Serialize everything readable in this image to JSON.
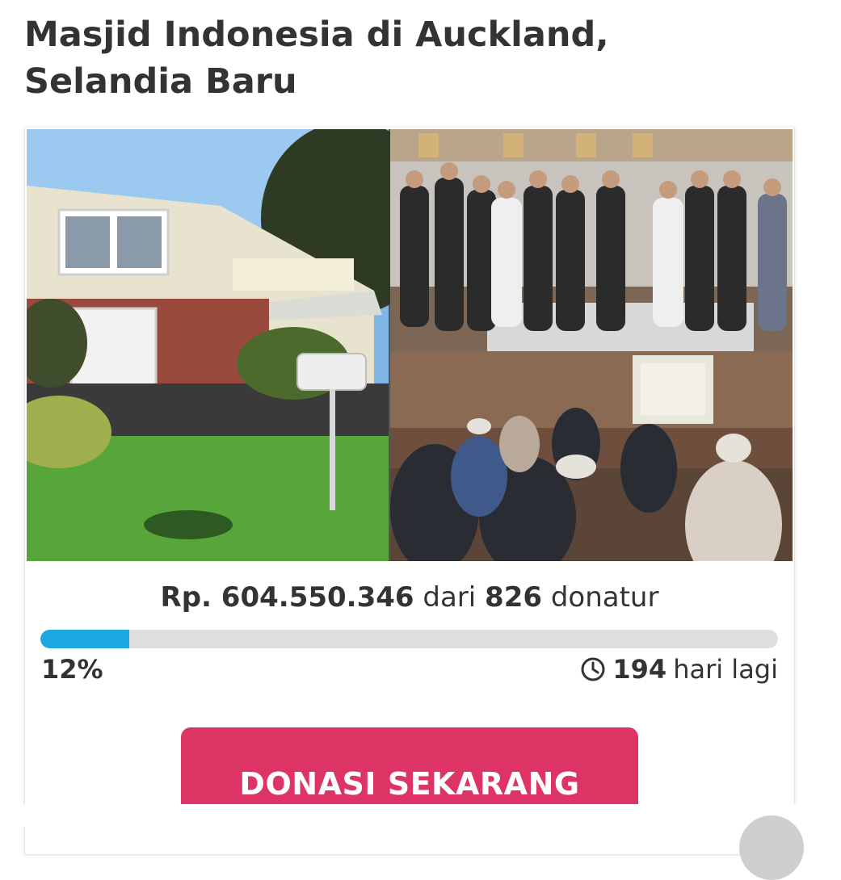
{
  "campaign": {
    "title": "Masjid Indonesia di Auckland, Selandia Baru",
    "amount": "Rp. 604.550.346",
    "amount_connector": "dari",
    "donor_count": "826",
    "donor_label": "donatur",
    "progress_percent": 12,
    "progress_label": "12%",
    "days_left": "194",
    "days_label": "hari lagi",
    "cta_label": "DONASI SEKARANG"
  },
  "colors": {
    "progress_fill": "#1ba7e0",
    "progress_track": "#dedede",
    "cta_background": "#dd3465",
    "text": "#333333"
  },
  "icons": {
    "days": "clock-icon"
  }
}
